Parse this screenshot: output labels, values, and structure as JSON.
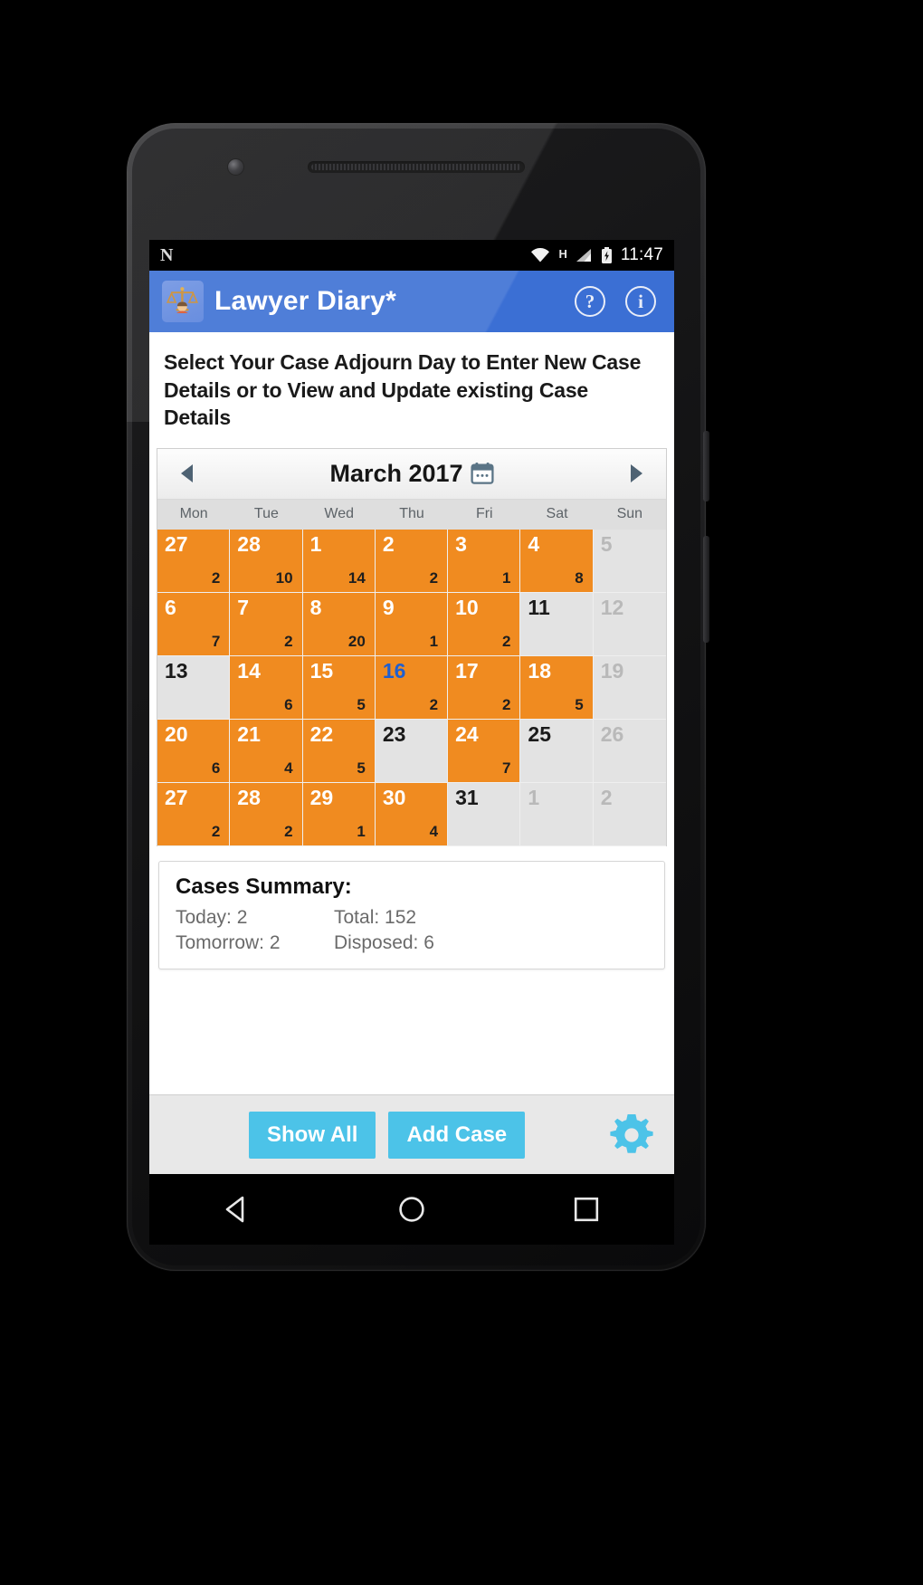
{
  "statusbar": {
    "logo": "N",
    "time": "11:47",
    "network_type": "H",
    "icons": [
      "wifi-icon",
      "signal-icon",
      "battery-charging-icon"
    ]
  },
  "appbar": {
    "title": "Lawyer Diary*",
    "logo_icon": "scales-of-justice-icon",
    "help_label": "?",
    "info_label": "i"
  },
  "instruction": "Select Your Case Adjourn Day to Enter New Case Details or to View and Update existing Case Details",
  "calendar": {
    "prev_label": "◀",
    "next_label": "▶",
    "month_title": "March 2017",
    "picker_icon": "calendar-icon",
    "weekdays": [
      "Mon",
      "Tue",
      "Wed",
      "Thu",
      "Fri",
      "Sat",
      "Sun"
    ],
    "weeks": [
      [
        {
          "day": "27",
          "count": "2",
          "state": "active"
        },
        {
          "day": "28",
          "count": "10",
          "state": "active"
        },
        {
          "day": "1",
          "count": "14",
          "state": "active"
        },
        {
          "day": "2",
          "count": "2",
          "state": "active"
        },
        {
          "day": "3",
          "count": "1",
          "state": "active"
        },
        {
          "day": "4",
          "count": "8",
          "state": "active"
        },
        {
          "day": "5",
          "count": "",
          "state": "muted"
        }
      ],
      [
        {
          "day": "6",
          "count": "7",
          "state": "active"
        },
        {
          "day": "7",
          "count": "2",
          "state": "active"
        },
        {
          "day": "8",
          "count": "20",
          "state": "active"
        },
        {
          "day": "9",
          "count": "1",
          "state": "active"
        },
        {
          "day": "10",
          "count": "2",
          "state": "active"
        },
        {
          "day": "11",
          "count": "",
          "state": "plain"
        },
        {
          "day": "12",
          "count": "",
          "state": "muted"
        }
      ],
      [
        {
          "day": "13",
          "count": "",
          "state": "plain"
        },
        {
          "day": "14",
          "count": "6",
          "state": "active"
        },
        {
          "day": "15",
          "count": "5",
          "state": "active"
        },
        {
          "day": "16",
          "count": "2",
          "state": "today"
        },
        {
          "day": "17",
          "count": "2",
          "state": "active"
        },
        {
          "day": "18",
          "count": "5",
          "state": "active"
        },
        {
          "day": "19",
          "count": "",
          "state": "muted"
        }
      ],
      [
        {
          "day": "20",
          "count": "6",
          "state": "active"
        },
        {
          "day": "21",
          "count": "4",
          "state": "active"
        },
        {
          "day": "22",
          "count": "5",
          "state": "active"
        },
        {
          "day": "23",
          "count": "",
          "state": "plain"
        },
        {
          "day": "24",
          "count": "7",
          "state": "active"
        },
        {
          "day": "25",
          "count": "",
          "state": "plain"
        },
        {
          "day": "26",
          "count": "",
          "state": "muted"
        }
      ],
      [
        {
          "day": "27",
          "count": "2",
          "state": "active"
        },
        {
          "day": "28",
          "count": "2",
          "state": "active"
        },
        {
          "day": "29",
          "count": "1",
          "state": "active"
        },
        {
          "day": "30",
          "count": "4",
          "state": "active"
        },
        {
          "day": "31",
          "count": "",
          "state": "plain"
        },
        {
          "day": "1",
          "count": "",
          "state": "muted"
        },
        {
          "day": "2",
          "count": "",
          "state": "muted"
        }
      ]
    ]
  },
  "summary": {
    "title": "Cases Summary:",
    "today": "Today: 2",
    "total": "Total: 152",
    "tomorrow": "Tomorrow: 2",
    "disposed": "Disposed: 6"
  },
  "bottombar": {
    "show_all_label": "Show All",
    "add_case_label": "Add Case",
    "settings_icon": "gear-icon"
  },
  "navbar": {
    "back_icon": "back-triangle-icon",
    "home_icon": "home-circle-icon",
    "recents_icon": "recents-square-icon"
  },
  "colors": {
    "appbar_blue": "#3b6fd4",
    "active_day_orange": "#f08b20",
    "button_cyan": "#4cc3e8",
    "today_blue": "#1f5fd0"
  }
}
